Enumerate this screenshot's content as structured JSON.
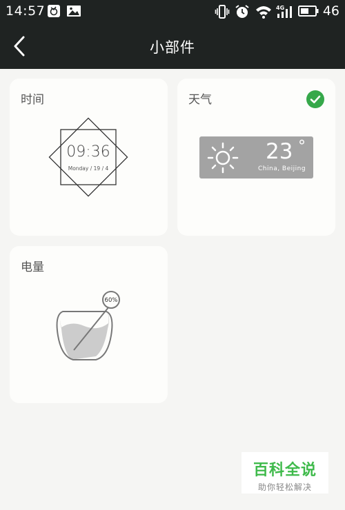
{
  "status_bar": {
    "time": "14:57",
    "battery_level": "46",
    "icons": [
      "app-notification-icon",
      "image-notification-icon",
      "vibrate-icon",
      "alarm-icon",
      "wifi-icon",
      "4g-signal-icon",
      "battery-icon"
    ]
  },
  "app_bar": {
    "title": "小部件"
  },
  "widgets": {
    "clock": {
      "label": "时间",
      "time": "09:36",
      "date": "Monday / 19 / 4"
    },
    "weather": {
      "label": "天气",
      "temperature": "23",
      "degree_symbol": "°",
      "location": "China, Beijing",
      "selected": true
    },
    "battery": {
      "label": "电量",
      "percent_label": "60%",
      "level": 0.6
    }
  },
  "watermark": {
    "title": "百科全说",
    "subtitle": "助你轻松解决"
  },
  "colors": {
    "header": "#1f2322",
    "background": "#f5f5f3",
    "card": "#fdfdfb",
    "check_green": "#36a84a",
    "weather_box": "#a3a3a3",
    "watermark_green": "#3fba4b"
  }
}
